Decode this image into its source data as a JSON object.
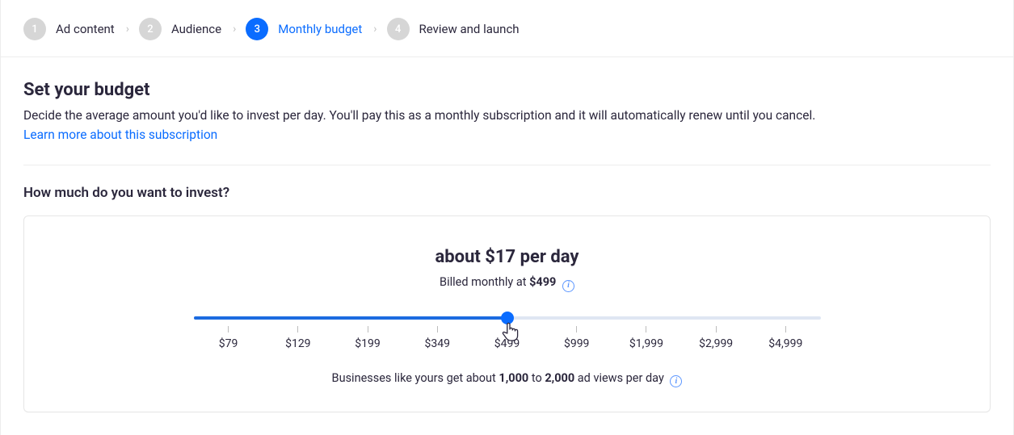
{
  "stepper": {
    "steps": [
      {
        "num": "1",
        "label": "Ad content",
        "active": false
      },
      {
        "num": "2",
        "label": "Audience",
        "active": false
      },
      {
        "num": "3",
        "label": "Monthly budget",
        "active": true
      },
      {
        "num": "4",
        "label": "Review and launch",
        "active": false
      }
    ]
  },
  "title": "Set your budget",
  "subtitle": "Decide the average amount you'd like to invest per day. You'll pay this as a monthly subscription and it will automatically renew until you cancel.",
  "learn_more": "Learn more about this subscription",
  "question": "How much do you want to invest?",
  "card": {
    "per_day": "about $17 per day",
    "billed_prefix": "Billed monthly at ",
    "billed_amount": "$499",
    "slider": {
      "ticks": [
        "$79",
        "$129",
        "$199",
        "$349",
        "$499",
        "$999",
        "$1,999",
        "$2,999",
        "$4,999"
      ],
      "selected_index": 4,
      "fill_percent": 50
    },
    "hint_prefix": "Businesses like yours get about ",
    "hint_low": "1,000",
    "hint_mid": " to ",
    "hint_high": "2,000",
    "hint_suffix": " ad views per day"
  }
}
